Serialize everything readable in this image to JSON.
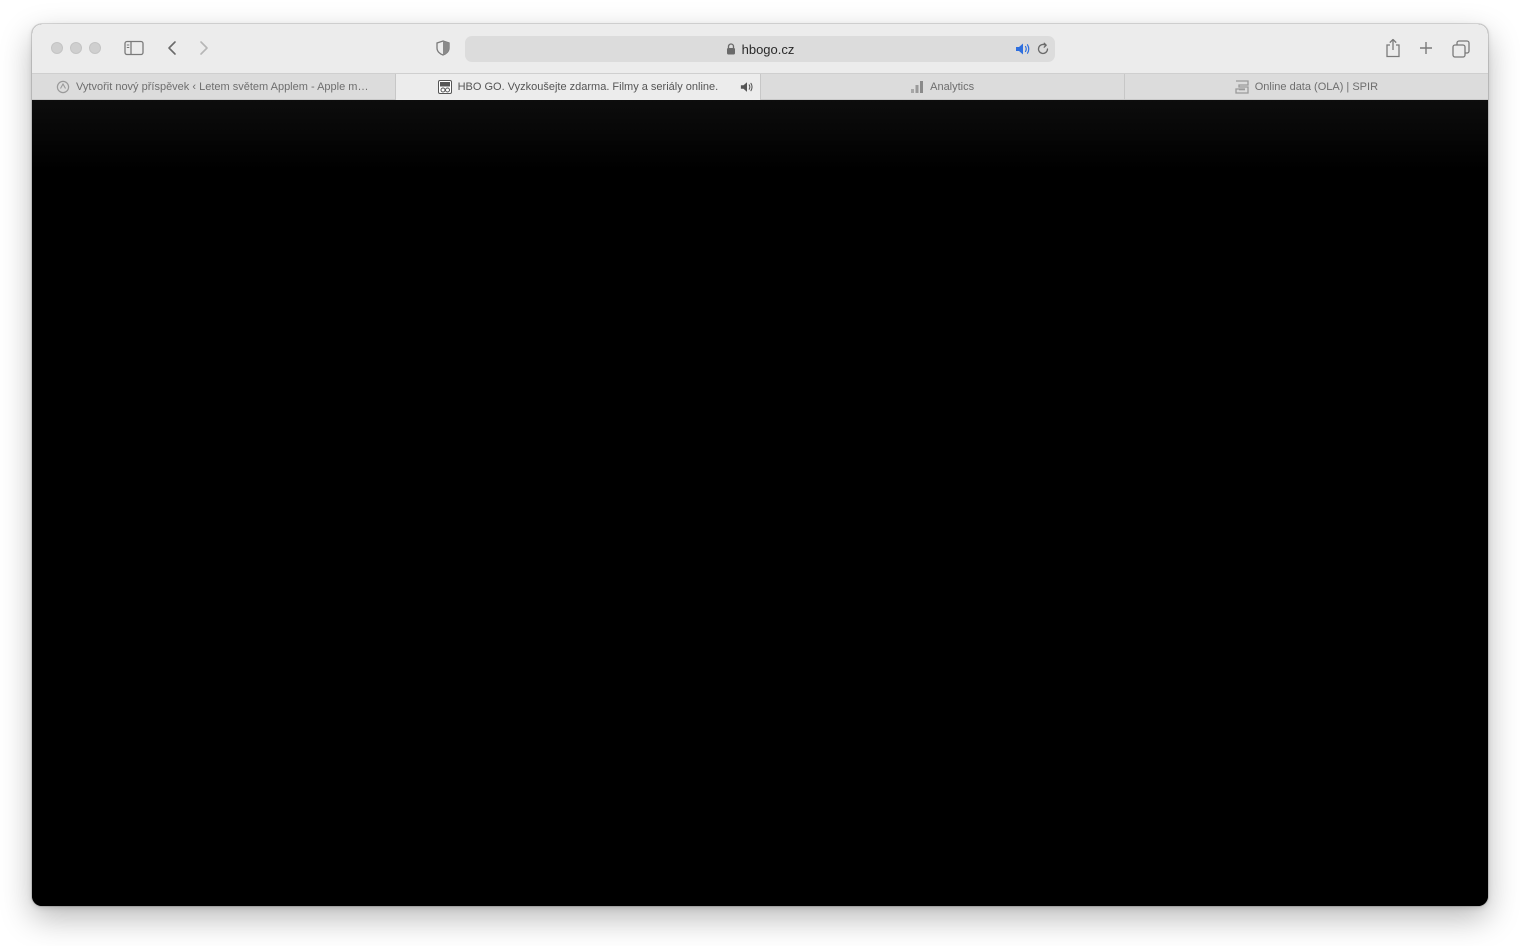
{
  "address_bar": {
    "url": "hbogo.cz"
  },
  "tabs": [
    {
      "label": "Vytvořit nový příspěvek ‹ Letem světem Applem - Apple ma...",
      "favicon": "circle-logo-icon",
      "active": false
    },
    {
      "label": "HBO GO. Vyzkoušejte zdarma. Filmy a seriály online.",
      "favicon": "hbo-go-icon",
      "active": true,
      "audio": true
    },
    {
      "label": "Analytics",
      "favicon": "bar-chart-icon",
      "active": false
    },
    {
      "label": "Online data (OLA) | SPIR",
      "favicon": "spir-logo-icon",
      "active": false
    }
  ],
  "colors": {
    "toolbar": "#ececec",
    "tabbar": "#dcdcdc",
    "content": "#000000",
    "audio_accent": "#2f6fde"
  }
}
